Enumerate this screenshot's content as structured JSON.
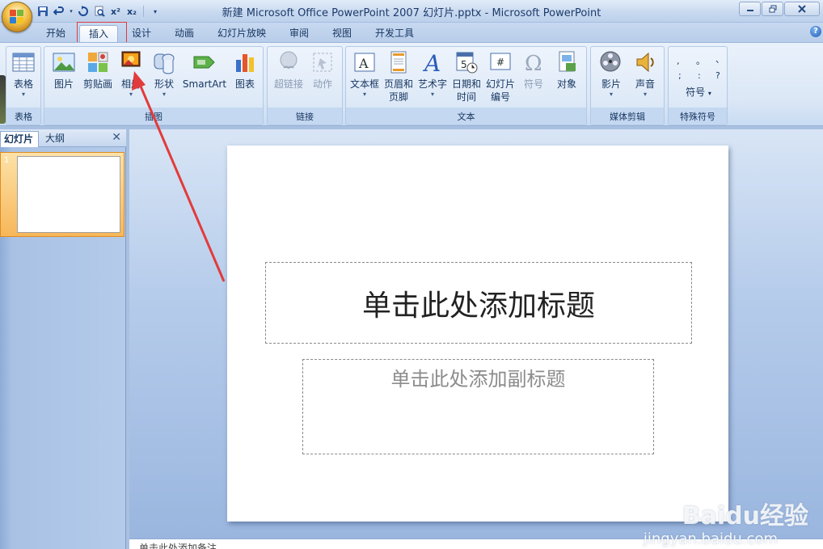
{
  "window": {
    "title": "新建 Microsoft Office PowerPoint 2007 幻灯片.pptx - Microsoft PowerPoint"
  },
  "tabs": [
    "开始",
    "插入",
    "设计",
    "动画",
    "幻灯片放映",
    "审阅",
    "视图",
    "开发工具"
  ],
  "active_tab": "插入",
  "ribbon": {
    "groups": {
      "table": {
        "label": "表格",
        "buttons": [
          "表格"
        ]
      },
      "illustrations": {
        "label": "插图",
        "buttons": [
          "图片",
          "剪贴画",
          "相册",
          "形状",
          "SmartArt",
          "图表"
        ]
      },
      "links": {
        "label": "链接",
        "buttons": [
          "超链接",
          "动作"
        ]
      },
      "text": {
        "label": "文本",
        "buttons": [
          "文本框",
          "页眉和",
          "页脚",
          "艺术字",
          "日期和",
          "时间",
          "幻灯片",
          "编号",
          "符号",
          "对象"
        ]
      },
      "media": {
        "label": "媒体剪辑",
        "buttons": [
          "影片",
          "声音"
        ]
      },
      "special": {
        "label": "特殊符号",
        "buttons": [
          "符号"
        ]
      }
    }
  },
  "left_pane": {
    "tabs": [
      "幻灯片",
      "大纲"
    ],
    "close": "✕",
    "slide_number": "1"
  },
  "slide": {
    "title_placeholder": "单击此处添加标题",
    "subtitle_placeholder": "单击此处添加副标题"
  },
  "notes": {
    "placeholder": "单击此处添加备注"
  },
  "watermark": {
    "brand": "Baidu经验",
    "url": "jingyan.baidu.com"
  },
  "colors": {
    "annotation": "#e23b3b",
    "ribbon_bg": "#dbe7f6",
    "selected_slide": "#f7b75a"
  }
}
